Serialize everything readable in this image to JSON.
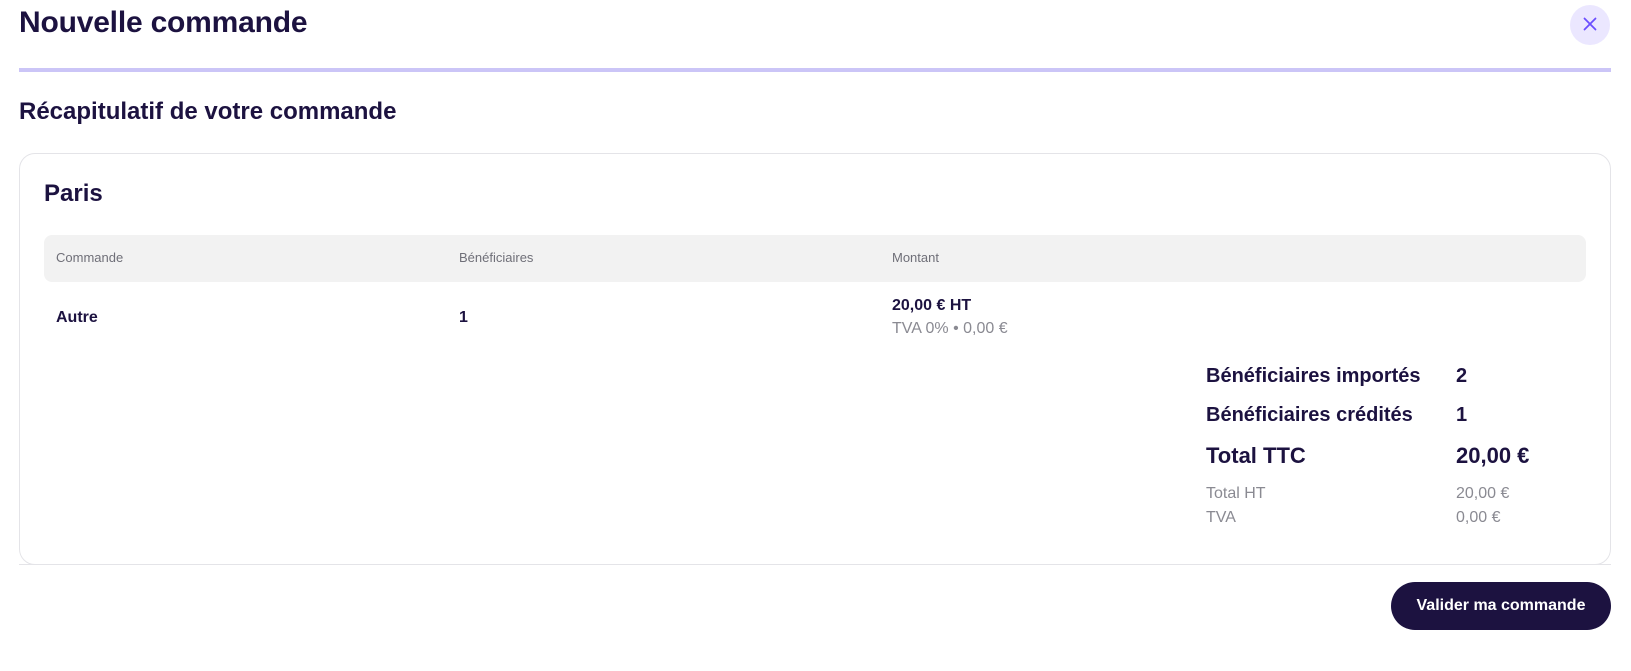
{
  "header": {
    "title": "Nouvelle commande",
    "close_icon": "close-icon"
  },
  "colors": {
    "accent": "#6b4eff",
    "dark": "#1c1240",
    "divider": "#cbc5f7",
    "close_bg": "#ebe7ff",
    "table_head_bg": "#f2f2f2",
    "muted": "#8a8a92"
  },
  "summary": {
    "title": "Récapitulatif de votre commande",
    "card": {
      "title": "Paris",
      "columns": [
        "Commande",
        "Bénéficiaires",
        "Montant"
      ],
      "rows": [
        {
          "command": "Autre",
          "beneficiaries": "1",
          "amount": "20,00 € HT",
          "vat": "TVA 0% • 0,00 €"
        }
      ],
      "totals": {
        "imported_label": "Bénéficiaires importés",
        "imported_value": "2",
        "credited_label": "Bénéficiaires crédités",
        "credited_value": "1",
        "total_ttc_label": "Total TTC",
        "total_ttc_value": "20,00 €",
        "total_ht_label": "Total HT",
        "total_ht_value": "20,00 €",
        "tva_label": "TVA",
        "tva_value": "0,00 €"
      }
    }
  },
  "footer": {
    "submit_label": "Valider ma commande"
  }
}
